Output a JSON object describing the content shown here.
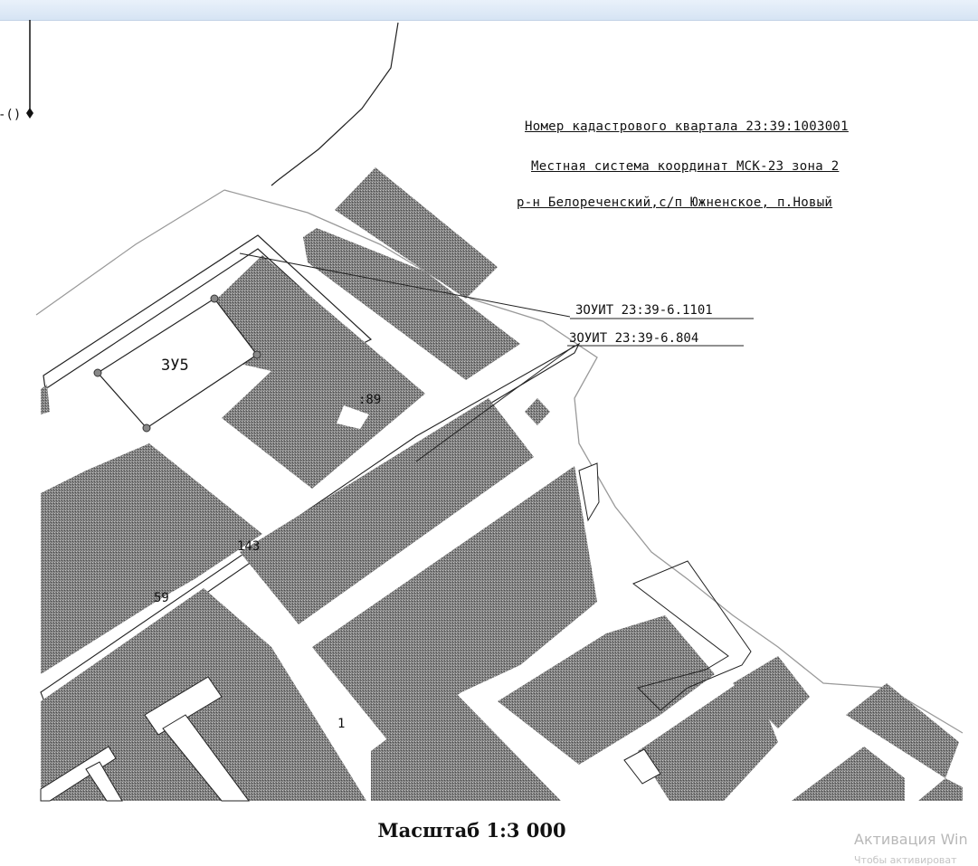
{
  "header": {
    "quarter_number": "Номер кадастрового квартала 23:39:1003001",
    "coordinate_system": "Местная система координат МСК-23 зона 2",
    "locality": "р-н Белореченский,с/п Южненское, п.Новый"
  },
  "zones": {
    "zouit_1": "ЗОУИТ 23:39-6.1101",
    "zouit_2": "ЗОУИТ 23:39-6.804"
  },
  "map_labels": {
    "land_plot": "ЗУ5",
    "parcel_89": ":89",
    "parcel_143": "143",
    "parcel_59": "59",
    "parcel_1": "1",
    "edge_fragment": "-()"
  },
  "footer": {
    "scale": "Масштаб 1:3 000"
  },
  "overlay": {
    "activation_title": "Активация Win",
    "activation_hint": "Чтобы активироват"
  },
  "colors": {
    "parcel_fill": "#6e6e6e",
    "land_plot_outline": "#222222",
    "background": "#ffffff"
  }
}
